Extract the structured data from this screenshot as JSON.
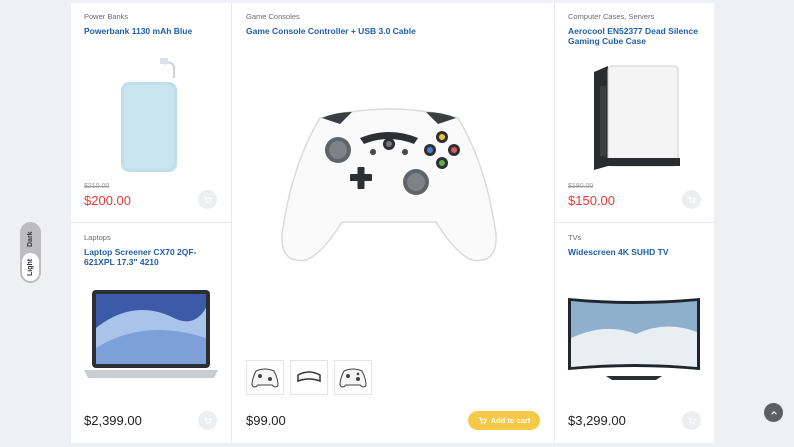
{
  "theme_toggle": {
    "dark_label": "Dark",
    "light_label": "Light"
  },
  "products": [
    {
      "category": "Power Banks",
      "title": "Powerbank 1130 mAh Blue",
      "old_price": "$210.00",
      "price": "$200.00"
    },
    {
      "category": "Game Consoles",
      "title": "Game Console Controller + USB 3.0 Cable",
      "price": "$99.00",
      "add_to_cart_label": "Add to cart"
    },
    {
      "category": "Computer Cases, Servers",
      "title": "Aerocool EN52377 Dead Silence Gaming Cube Case",
      "old_price": "$180.00",
      "price": "$150.00"
    },
    {
      "category": "Laptops",
      "title": "Laptop Screener CX70 2QF-621XPL 17.3\" 4210",
      "price": "$2,399.00"
    },
    {
      "category": "TVs",
      "title": "Widescreen 4K SUHD TV",
      "price": "$3,299.00"
    }
  ],
  "colors": {
    "accent": "#f7c948",
    "link": "#1f5fa6",
    "sale": "#e53935"
  },
  "icons": [
    "cart-icon",
    "chevron-up-icon"
  ]
}
